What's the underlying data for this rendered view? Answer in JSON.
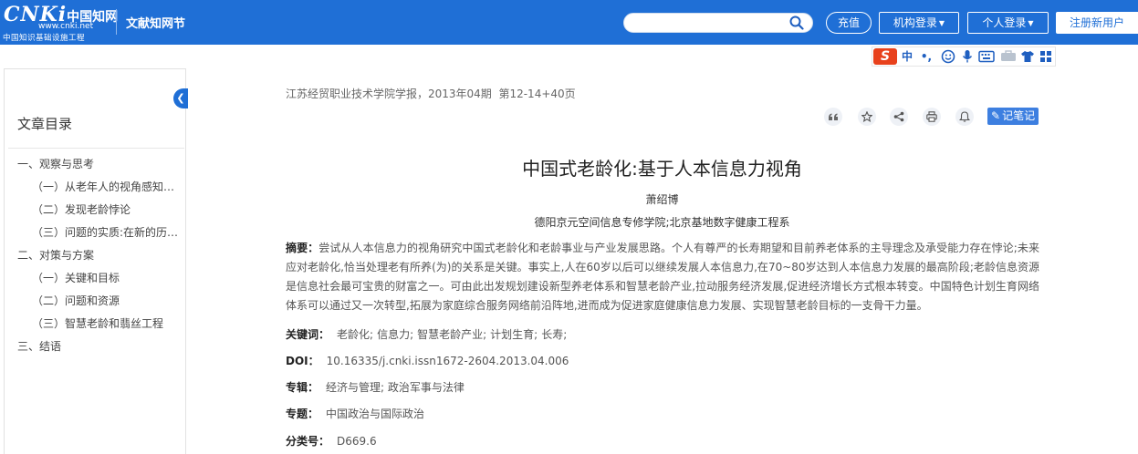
{
  "header": {
    "logo_text": "CNKi",
    "logo_cn": "中国知网",
    "logo_url": "www.cnki.net",
    "logo_subtitle": "中国知识基础设施工程",
    "site_name": "文献知网节",
    "search_placeholder": "",
    "recharge_label": "充值",
    "org_login_label": "机构登录",
    "personal_login_label": "个人登录",
    "register_label": "注册新用户"
  },
  "ime_toolbar": {
    "logo": "S",
    "lang": "中",
    "punct": "•,"
  },
  "sidebar": {
    "title": "文章目录",
    "items": [
      {
        "label": "一、观察与思考",
        "level": 1
      },
      {
        "label": "（一）从老年人的视角感知老龄化",
        "level": 2
      },
      {
        "label": "（二）发现老龄悖论",
        "level": 2
      },
      {
        "label": "（三）问题的实质:在新的历史条件下",
        "level": 2
      },
      {
        "label": "二、对策与方案",
        "level": 1
      },
      {
        "label": "（一）关键和目标",
        "level": 2
      },
      {
        "label": "（二）问题和资源",
        "level": 2
      },
      {
        "label": "（三）智慧老龄和翡丝工程",
        "level": 2
      },
      {
        "label": "三、结语",
        "level": 1
      }
    ]
  },
  "article": {
    "source": "江苏经贸职业技术学院学报，2013年04期",
    "pages": "第12-14+40页",
    "note_label": "记笔记",
    "title": "中国式老龄化:基于人本信息力视角",
    "author": "萧绍博",
    "affiliation": "德阳京元空间信息专修学院;北京基地数字健康工程系",
    "abstract_label": "摘要：",
    "abstract": "尝试从人本信息力的视角研究中国式老龄化和老龄事业与产业发展思路。个人有尊严的长寿期望和目前养老体系的主导理念及承受能力存在悖论;未来应对老龄化,恰当处理老有所养(为)的关系是关键。事实上,人在60岁以后可以继续发展人本信息力,在70~80岁达到人本信息力发展的最高阶段;老龄信息资源是信息社会最可宝贵的财富之一。可由此出发规划建设新型养老体系和智慧老龄产业,拉动服务经济发展,促进经济增长方式根本转变。中国特色计划生育网络体系可以通过又一次转型,拓展为家庭综合服务网络前沿阵地,进而成为促进家庭健康信息力发展、实现智慧老龄目标的一支骨干力量。",
    "keywords_label": "关键词：",
    "keywords": [
      "老龄化;",
      "信息力;",
      "智慧老龄产业;",
      "计划生育;",
      "长寿;"
    ],
    "doi_label": "DOI：",
    "doi": "10.16335/j.cnki.issn1672-2604.2013.04.006",
    "series_label": "专辑：",
    "series": "经济与管理; 政治军事与法律",
    "subject_label": "专题：",
    "subject": "中国政治与国际政治",
    "class_label": "分类号：",
    "class_no": "D669.6"
  },
  "colors": {
    "brand_blue": "#1f6fd6",
    "note_blue": "#3d7fe0"
  }
}
